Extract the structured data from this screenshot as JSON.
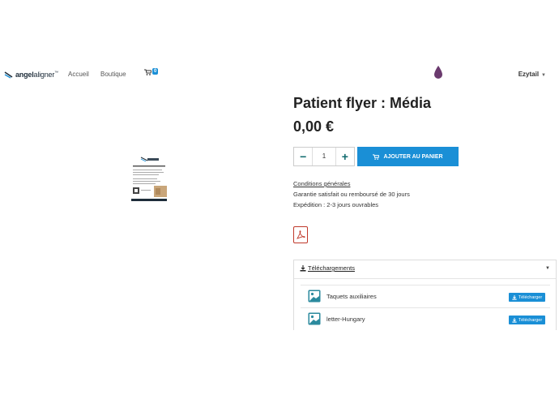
{
  "nav": {
    "logo_bold": "angel",
    "logo_rest": "aligner",
    "logo_tm": "™",
    "links": [
      "Accueil",
      "Boutique"
    ],
    "cart_icon": "cart-icon",
    "cart_count": "0",
    "user": "Ezytail",
    "user_caret": "▼",
    "drop_icon": "drop-icon",
    "drop_color": "#6b3a6e"
  },
  "product": {
    "title": "Patient flyer : Média",
    "price": "0,00 €",
    "quantity": "1",
    "minus": "−",
    "plus": "+",
    "add_to_cart": "AJOUTER AU PANIER",
    "terms_link": "Conditions générales",
    "guarantee": "Garantie satisfait ou remboursé de 30 jours",
    "shipping": "Expédition : 2-3 jours ouvrables",
    "pdf_icon": "pdf-icon"
  },
  "downloads": {
    "header": "Téléchargements",
    "caret": "▼",
    "items": [
      {
        "name": "Taquets auxiliaires",
        "button": "Télécharger"
      },
      {
        "name": "letter-Hungary",
        "button": "Télécharger"
      }
    ]
  },
  "colors": {
    "accent": "#1a8fd6",
    "stepper": "#0f6a6e",
    "pdf": "#c0392b"
  }
}
